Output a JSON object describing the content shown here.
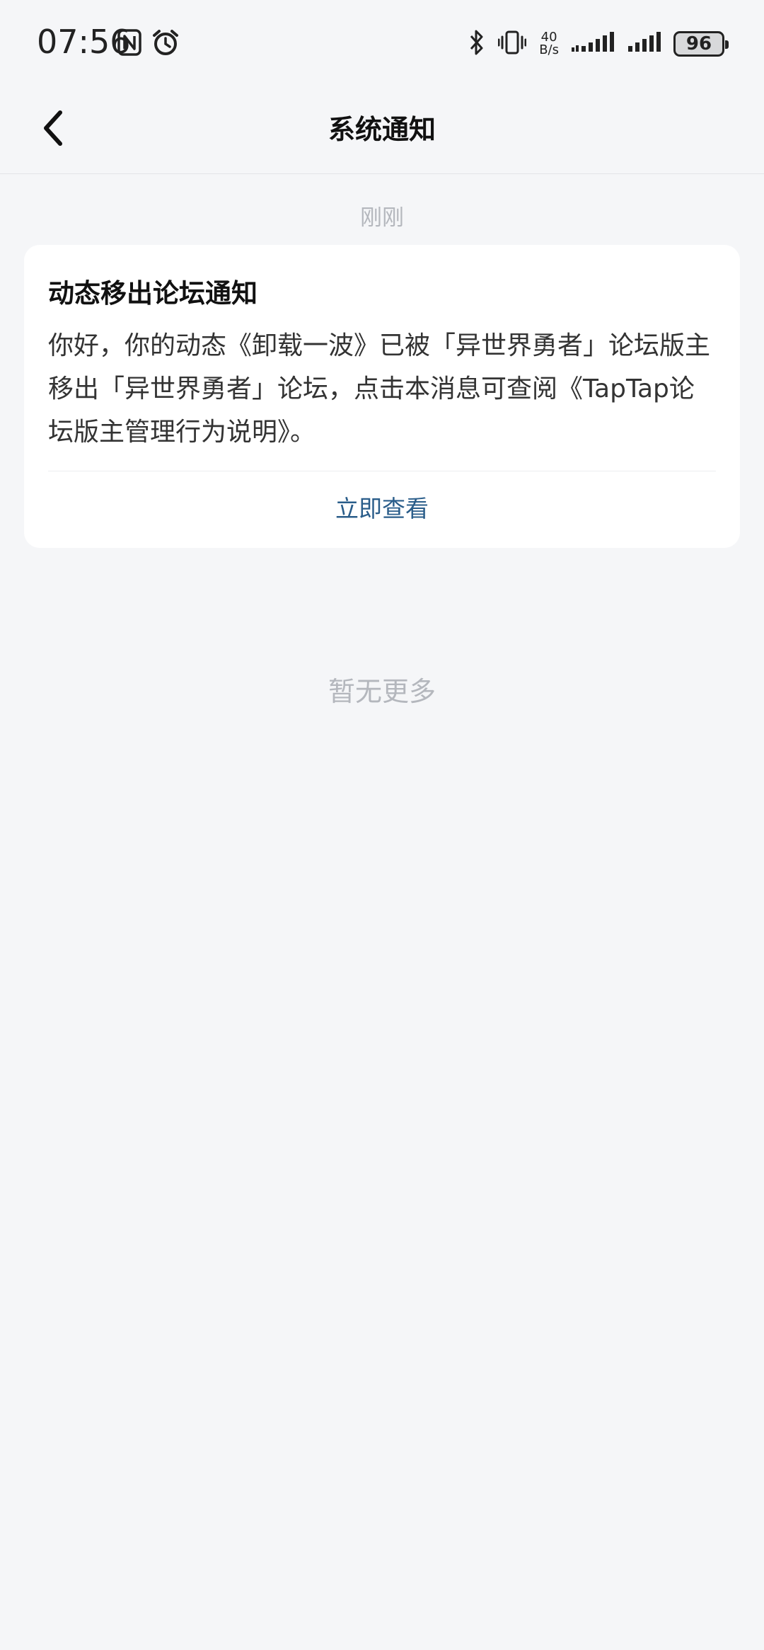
{
  "status_bar": {
    "time": "07:56",
    "left_icons": [
      "nfc-icon",
      "alarm-icon"
    ],
    "right_icons": [
      "bluetooth-icon",
      "vibrate-icon",
      "signal-icon",
      "signal-icon"
    ],
    "net_speed_value": "40",
    "net_speed_unit": "B/s",
    "battery": "96"
  },
  "header": {
    "back_icon": "chevron-left-icon",
    "title": "系统通知"
  },
  "notifications": [
    {
      "time": "刚刚",
      "title": "动态移出论坛通知",
      "body": "你好，你的动态《卸载一波》已被「异世界勇者」论坛版主移出「异世界勇者」论坛，点击本消息可查阅《TapTap论坛版主管理行为说明》。",
      "action": "立即查看"
    }
  ],
  "footer": {
    "no_more": "暂无更多"
  },
  "colors": {
    "background": "#f5f6f8",
    "card": "#ffffff",
    "link": "#2a5d8a",
    "muted": "#b4b7bd"
  }
}
